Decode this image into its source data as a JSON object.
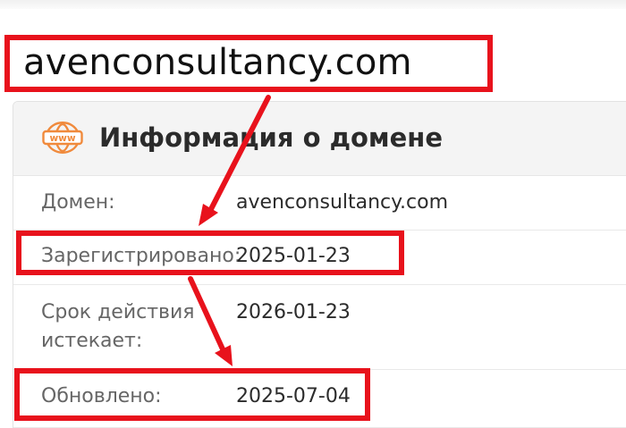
{
  "domain": "avenconsultancy.com",
  "card": {
    "icon": "www-globe-icon",
    "icon_text": "www",
    "title": "Информация о домене"
  },
  "rows": [
    {
      "label": "Домен:",
      "value": "avenconsultancy.com"
    },
    {
      "label": "Зарегистрировано:",
      "value": "2025-01-23"
    },
    {
      "label": "Срок действия истекает:",
      "value": "2026-01-23"
    },
    {
      "label": "Обновлено:",
      "value": "2025-07-04"
    }
  ],
  "colors": {
    "highlight": "#e8121c",
    "icon": "#f08a3c",
    "header_bg": "#f4f4f4"
  }
}
